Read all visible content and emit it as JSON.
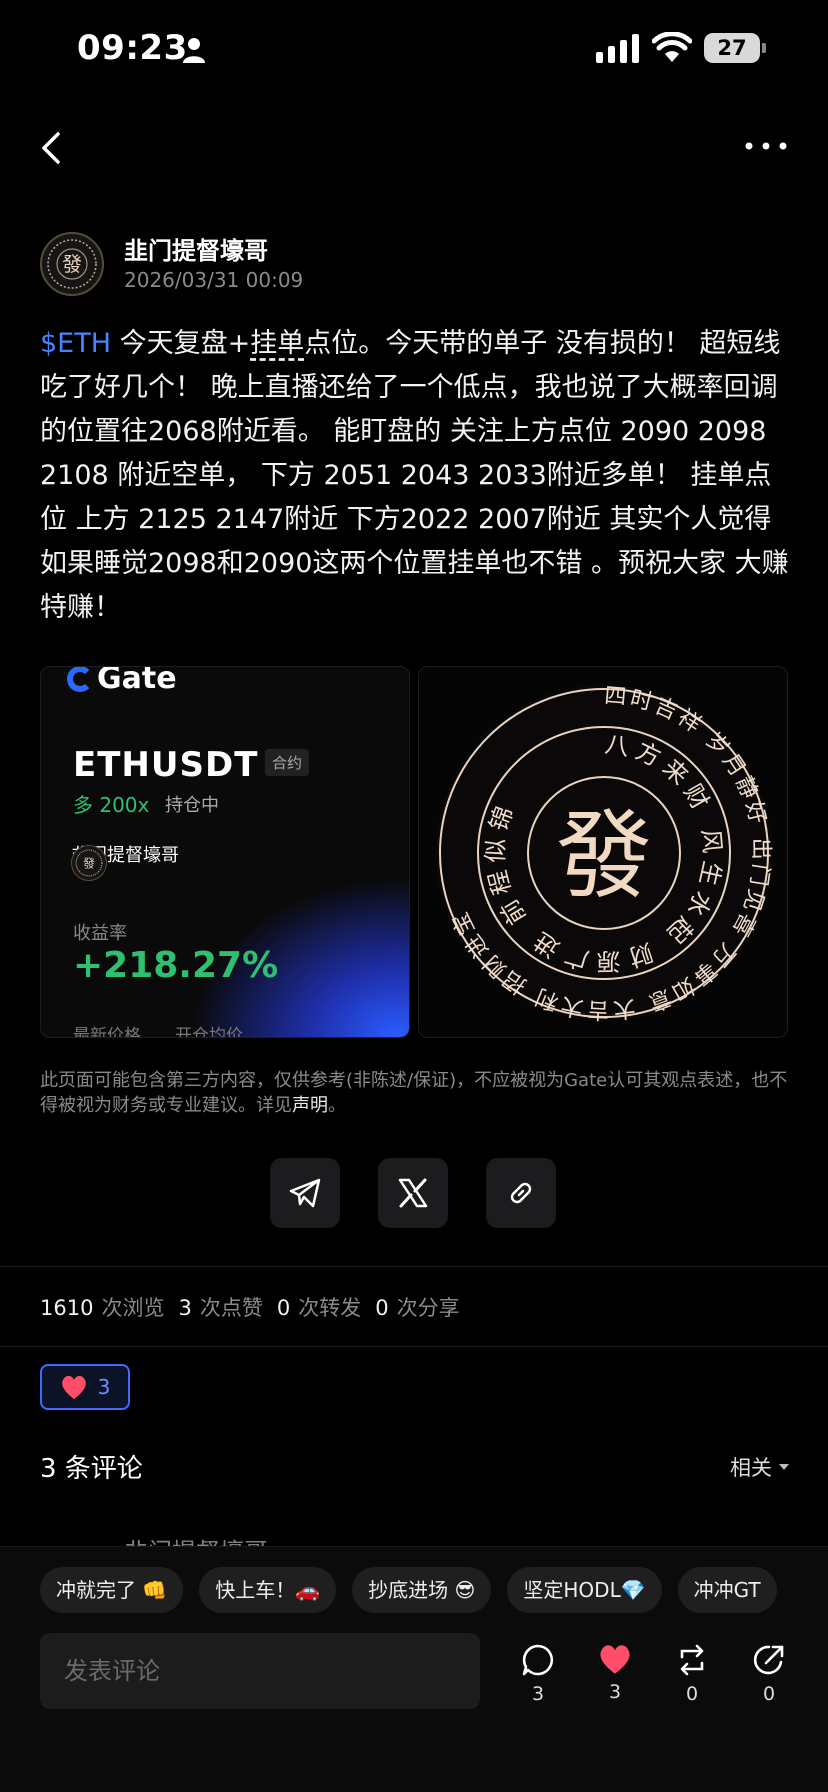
{
  "status_bar": {
    "time": "09:23",
    "battery": "27"
  },
  "post": {
    "author": "韭门提督壕哥",
    "time": "2026/03/31 00:09",
    "tag": "$ETH",
    "body_a": " 今天复盘+",
    "body_u": "挂单",
    "body_b": "点位。今天带的单子 没有损的！ 超短线吃了好几个！ 晚上直播还给了一个低点，我也说了大概率回调的位置往2068附近看。 能盯盘的 关注上方点位 2090 2098 2108 附近空单， 下方 2051 2043 2033附近多单！ 挂单点位 上方 2125 2147附近 下方2022 2007附近 其实个人觉得如果睡觉2098和2090这两个位置挂单也不错 。预祝大家 大赚特赚！"
  },
  "trade_card": {
    "brand": "Gate",
    "pair": "ETHUSDT",
    "contract": "合约",
    "direction": "多 200x",
    "status": "持仓中",
    "author": "韭门提督壕哥",
    "pnl_label": "收益率",
    "pnl_value": "+218.27%",
    "last_price_label": "最新价格",
    "entry_price_label": "开仓均价"
  },
  "talisman": {
    "center": "發",
    "inner_ring": "八方来财 风生水起 财源广进 前程似锦",
    "outer_ring": "四时吉祥 岁月静好 出门见喜 万事如意 大吉大利 招财进宝"
  },
  "disclaimer": {
    "text": "此页面可能包含第三方内容，仅供参考(非陈述/保证)，不应被视为Gate认可其观点表述，也不得被视为财务或专业建议。详见",
    "link": "声明",
    "end": "。"
  },
  "stats": {
    "views": "1610",
    "views_label": "次浏览",
    "likes": "3",
    "likes_label": "次点赞",
    "reposts": "0",
    "reposts_label": "次转发",
    "shares": "0",
    "shares_label": "次分享"
  },
  "like_chip": {
    "count": "3"
  },
  "comments": {
    "header": "3 条评论",
    "sort": "相关",
    "peek_author": "韭门提督壕哥"
  },
  "quick_replies": [
    "冲就完了 👊",
    "快上车！🚗",
    "抄底进场 😎",
    "坚定HODL💎",
    "冲冲GT"
  ],
  "composer": {
    "placeholder": "发表评论"
  },
  "actions": {
    "comments": "3",
    "likes": "3",
    "reposts": "0",
    "shares": "0"
  },
  "colors": {
    "accent": "#3b6cff",
    "tag": "#4a83ff",
    "gain": "#2fbf71",
    "like": "#ff4d6a"
  }
}
